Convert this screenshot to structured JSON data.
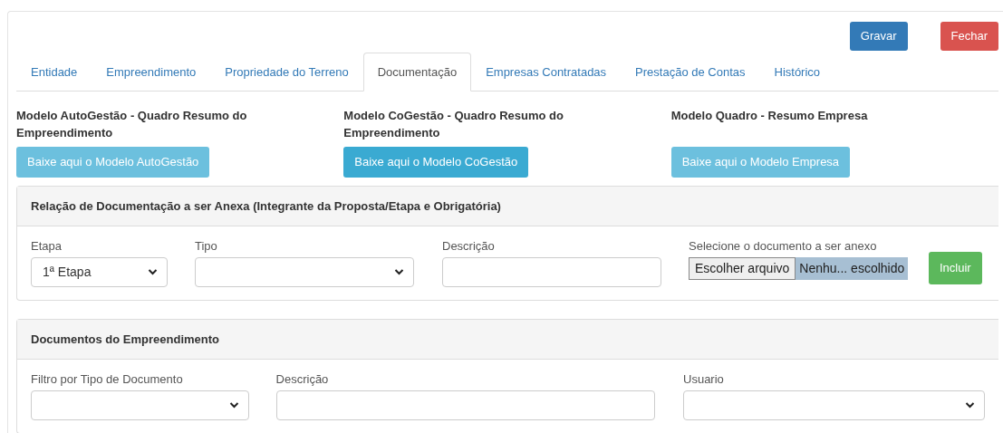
{
  "actions": [
    {
      "label": "Gravar",
      "kind": "primary"
    },
    {
      "label": "Fechar",
      "kind": "danger"
    }
  ],
  "tabs": [
    {
      "label": "Entidade",
      "selected": false
    },
    {
      "label": "Empreendimento",
      "selected": false
    },
    {
      "label": "Propriedade do Terreno",
      "selected": false
    },
    {
      "label": "Documentação",
      "selected": true
    },
    {
      "label": "Empresas Contratadas",
      "selected": false
    },
    {
      "label": "Prestação de Contas",
      "selected": false
    },
    {
      "label": "Histórico",
      "selected": false
    }
  ],
  "models": [
    {
      "title": "Modelo AutoGestão - Quadro Resumo do Empreendimento",
      "button": "Baixe aqui o Modelo AutoGestão",
      "hovered": false
    },
    {
      "title": "Modelo CoGestão - Quadro Resumo do Empreendimento",
      "button": "Baixe aqui o Modelo CoGestão",
      "hovered": true
    },
    {
      "title": "Modelo Quadro - Resumo Empresa",
      "button": "Baixe aqui o Modelo Empresa",
      "hovered": false
    }
  ],
  "attach_panel": {
    "title": "Relação de Documentação a ser Anexa (Integrante da Proposta/Etapa e Obrigatória)",
    "fields": [
      {
        "kind": "select",
        "label": "Etapa",
        "value": "1ª Etapa"
      },
      {
        "kind": "select",
        "label": "Tipo"
      },
      {
        "kind": "text",
        "label": "Descrição"
      },
      {
        "kind": "file",
        "label": "Selecione o documento a ser anexo",
        "button": "Escolher arquivo",
        "status": "Nenhu... escolhido",
        "highlighted": true
      }
    ],
    "submit": "Incluir"
  },
  "documents_panel": {
    "title": "Documentos do Empreendimento",
    "fields": [
      {
        "kind": "select",
        "label": "Filtro por Tipo de Documento"
      },
      {
        "kind": "text",
        "label": "Descrição"
      },
      {
        "kind": "select",
        "label": "Usuario"
      }
    ]
  }
}
